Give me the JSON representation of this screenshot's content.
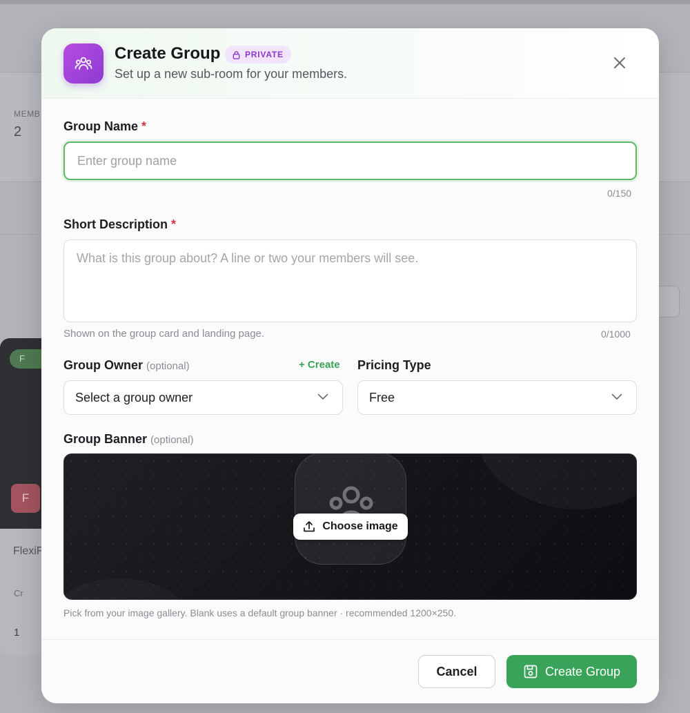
{
  "background": {
    "stat_label": "MEMB",
    "stat_value": "2",
    "card_badge": "F",
    "card_avatar": "F",
    "card_name": "FlexiF",
    "card_row1": "Cr",
    "card_row2": "1"
  },
  "modal": {
    "title": "Create Group",
    "privacy_badge": "PRIVATE",
    "subtitle": "Set up a new sub-room for your members.",
    "header_icon": "users-group-icon",
    "accent_color": "#9b43d8",
    "primary_color": "#3aa35a"
  },
  "group_name": {
    "label": "Group Name",
    "required_mark": "*",
    "placeholder": "Enter group name",
    "value": "",
    "counter": "0/150"
  },
  "description": {
    "label": "Short Description",
    "required_mark": "*",
    "placeholder": "What is this group about? A line or two your members will see.",
    "hint": "Shown on the group card and landing page.",
    "counter": "0/1000"
  },
  "owner": {
    "label": "Group Owner",
    "optional": "(optional)",
    "create_link": "+ Create",
    "selected": "Select a group owner"
  },
  "pricing": {
    "label": "Pricing Type",
    "selected": "Free"
  },
  "banner": {
    "label": "Group Banner",
    "optional": "(optional)",
    "choose_label": "Choose image",
    "hint": "Pick from your image gallery. Blank uses a default group banner · recommended 1200×250."
  },
  "footer": {
    "cancel_label": "Cancel",
    "create_label": "Create Group"
  }
}
